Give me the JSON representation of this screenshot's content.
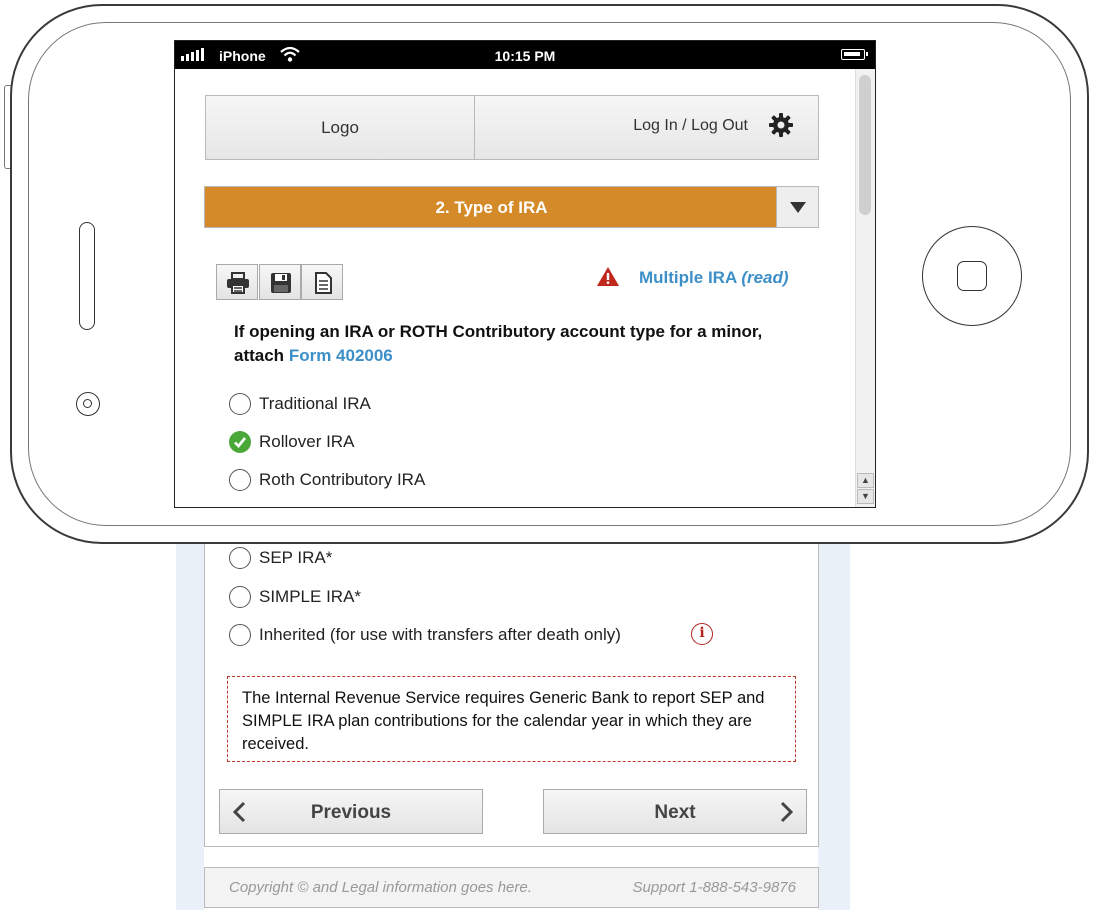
{
  "status_bar": {
    "carrier": "iPhone",
    "time": "10:15 PM"
  },
  "header": {
    "logo": "Logo",
    "login_label": "Log In / Log Out",
    "settings_icon": "gear-icon"
  },
  "step": {
    "title": "2. Type of IRA"
  },
  "panel": {
    "tools": [
      "print-icon",
      "save-icon",
      "document-icon"
    ],
    "alert_link_text": "Multiple IRA",
    "alert_link_suffix": "(read)",
    "question_text": "If opening an IRA or ROTH Contributory account type for a minor, attach",
    "question_link": "Form 402006",
    "options": [
      {
        "label": "Traditional IRA",
        "selected": false
      },
      {
        "label": "Rollover IRA",
        "selected": true
      },
      {
        "label": "Roth Contributory IRA",
        "selected": false
      },
      {
        "label": "SEP IRA*",
        "selected": false
      },
      {
        "label": "SIMPLE IRA*",
        "selected": false
      },
      {
        "label": "Inherited (for use with transfers after death only)",
        "selected": false
      }
    ],
    "info_icon_glyph": "i",
    "notice": "The Internal Revenue Service requires Generic Bank to report SEP and SIMPLE IRA plan contributions for the calendar year in which they are received."
  },
  "nav": {
    "previous": "Previous",
    "next": "Next"
  },
  "footer": {
    "copyright": "Copyright © and Legal information goes here.",
    "support": "Support 1-888-543-9876"
  },
  "colors": {
    "step_bar": "#d58a29",
    "link": "#3d8fc8",
    "alert": "#b3261e",
    "check": "#4aa838"
  }
}
